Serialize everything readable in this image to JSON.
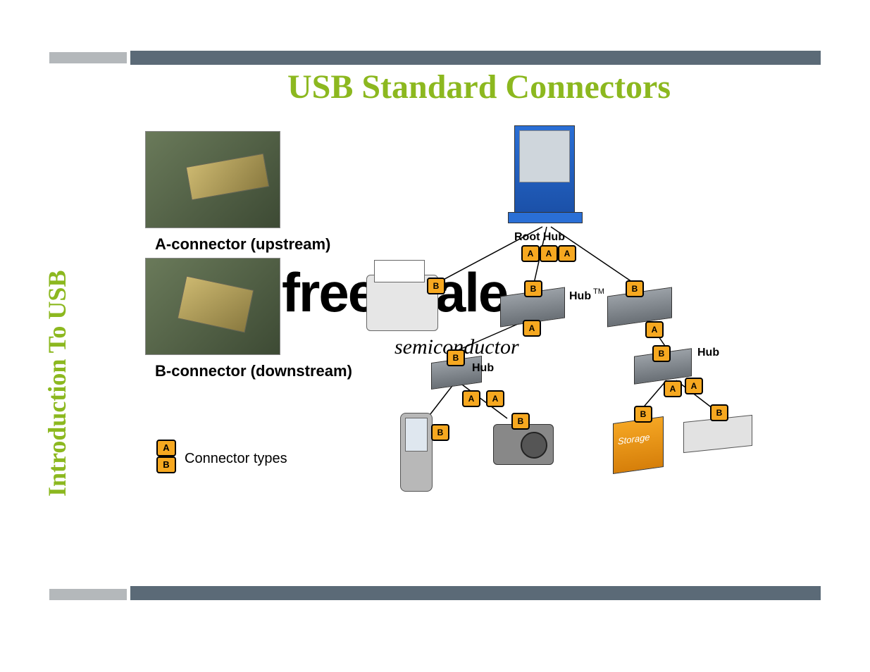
{
  "title": "USB Standard Connectors",
  "side_title": "Introduction To USB",
  "labels": {
    "a_connector": "A-connector (upstream)",
    "b_connector": "B-connector (downstream)",
    "connector_types": "Connector types",
    "root_hub": "Root Hub",
    "hub": "Hub",
    "storage": "Storage",
    "tm": "TM"
  },
  "watermark": {
    "line1": "freescale",
    "line2": "semiconductor"
  },
  "badges": {
    "A": "A",
    "B": "B"
  },
  "legend": {
    "A": "A",
    "B": "B"
  }
}
